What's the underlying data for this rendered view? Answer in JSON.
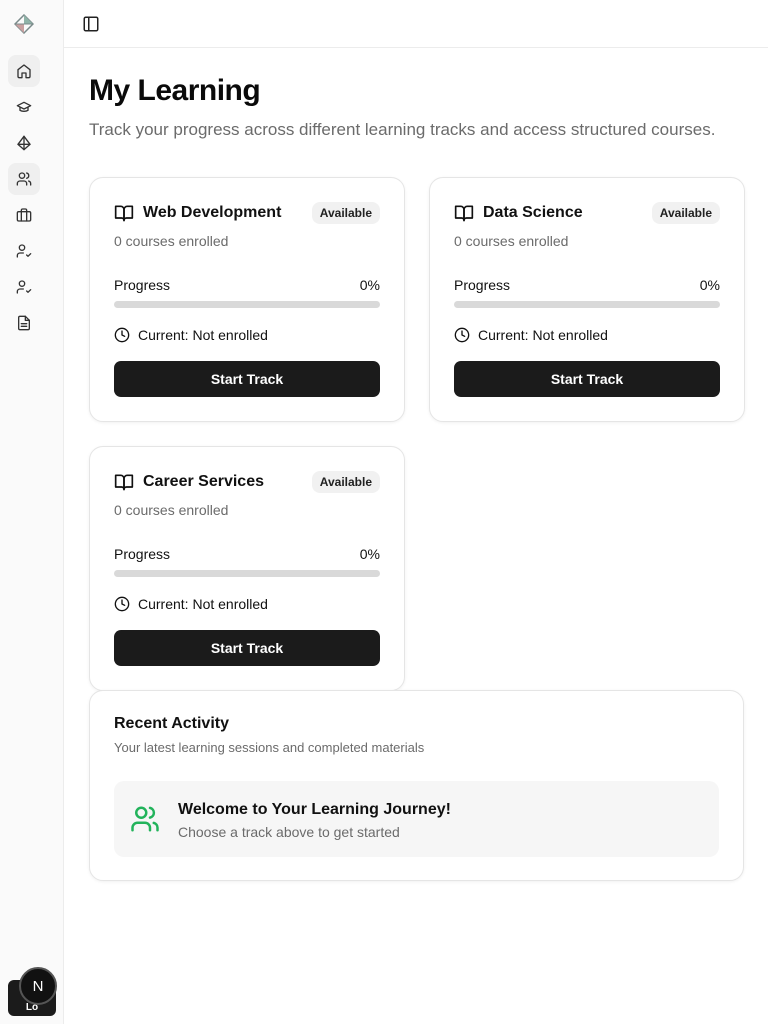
{
  "page": {
    "title": "My Learning",
    "subtitle": "Track your progress across different learning tracks and access structured courses."
  },
  "sidebar": {
    "items": [
      {
        "icon": "home-icon",
        "active": true
      },
      {
        "icon": "graduation-cap-icon",
        "active": false
      },
      {
        "icon": "diamond-icon",
        "active": false
      },
      {
        "icon": "users-icon",
        "active": true
      },
      {
        "icon": "briefcase-icon",
        "active": false
      },
      {
        "icon": "user-check-icon",
        "active": false
      },
      {
        "icon": "user-check-icon",
        "active": false
      },
      {
        "icon": "file-text-icon",
        "active": false
      }
    ],
    "bottom_badge": "N",
    "bottom_pill_text": "Lo"
  },
  "tracks": [
    {
      "title": "Web Development",
      "badge": "Available",
      "enrolled": "0 courses enrolled",
      "progress_label": "Progress",
      "progress_text": "0%",
      "progress": 0,
      "current": "Current: Not enrolled",
      "button": "Start Track"
    },
    {
      "title": "Data Science",
      "badge": "Available",
      "enrolled": "0 courses enrolled",
      "progress_label": "Progress",
      "progress_text": "0%",
      "progress": 0,
      "current": "Current: Not enrolled",
      "button": "Start Track"
    },
    {
      "title": "Career Services",
      "badge": "Available",
      "enrolled": "0 courses enrolled",
      "progress_label": "Progress",
      "progress_text": "0%",
      "progress": 0,
      "current": "Current: Not enrolled",
      "button": "Start Track"
    }
  ],
  "activity": {
    "title": "Recent Activity",
    "subtitle": "Your latest learning sessions and completed materials",
    "empty_title": "Welcome to Your Learning Journey!",
    "empty_subtitle": "Choose a track above to get started"
  },
  "colors": {
    "accent_green": "#22b35b",
    "button_bg": "#1b1b1b"
  }
}
